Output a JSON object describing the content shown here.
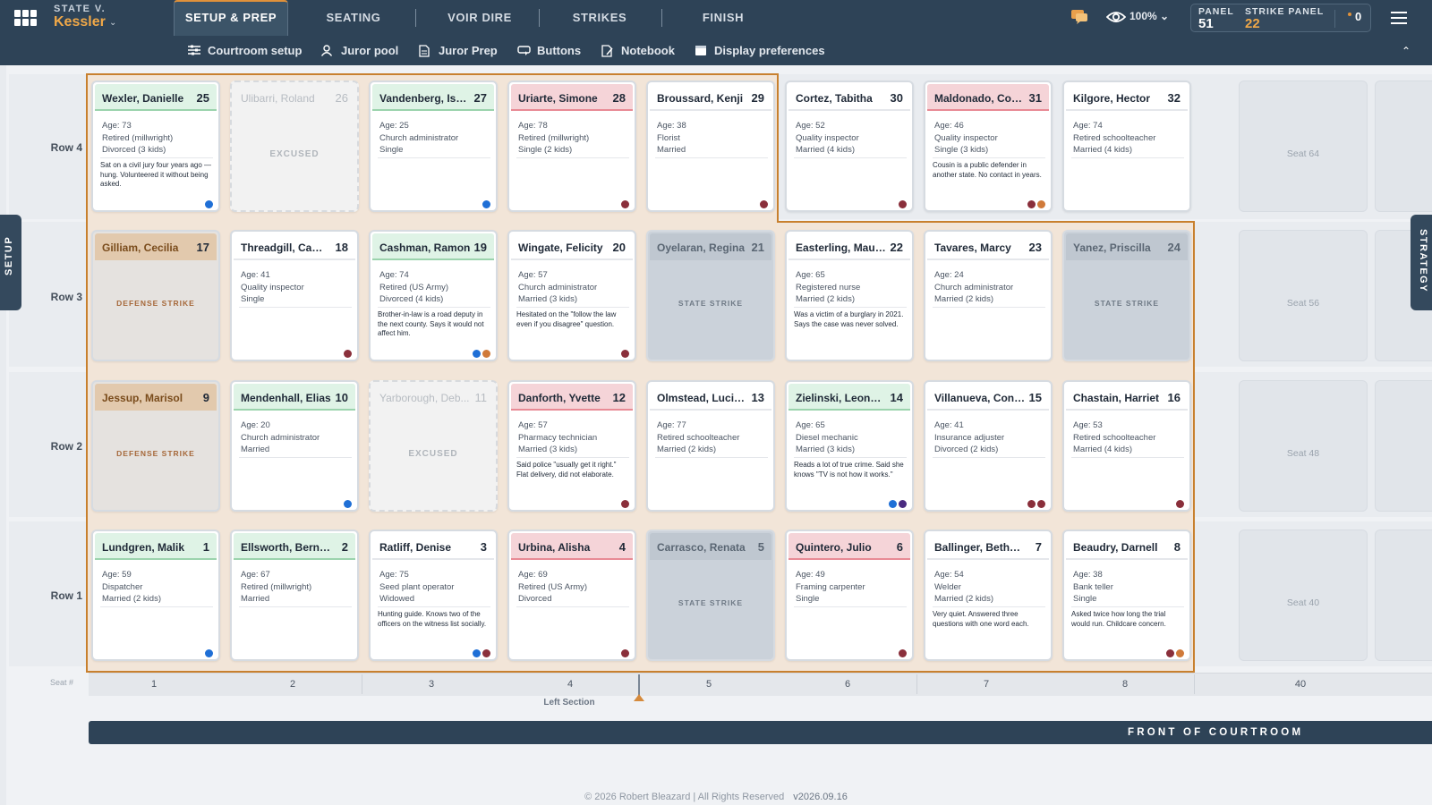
{
  "header": {
    "case_prefix": "STATE V.",
    "case_name": "Kessler",
    "tabs": [
      "SETUP & PREP",
      "SEATING",
      "VOIR DIRE",
      "STRIKES",
      "FINISH"
    ],
    "active_tab": "SETUP & PREP",
    "zoom": "100%",
    "panel_label": "PANEL",
    "panel_value": "51",
    "strike_label": "STRIKE PANEL",
    "strike_value": "22",
    "counter": "0"
  },
  "subnav": [
    "Courtroom setup",
    "Juror pool",
    "Juror Prep",
    "Buttons",
    "Notebook",
    "Display preferences"
  ],
  "side_tabs": {
    "left": "SETUP",
    "right": "STRATEGY"
  },
  "rows": [
    {
      "label": "Row 4",
      "seats": [
        {
          "name": "Wexler, Danielle",
          "seat": "25",
          "style": "green",
          "age": "Age: 73",
          "job": "Retired (millwright)",
          "family": "Divorced (3 kids)",
          "note": "Sat on a civil jury four years ago — hung. Volunteered it without being asked.",
          "dots": [
            "#1f6fd6"
          ]
        },
        {
          "name": "Ulibarri, Roland",
          "seat": "26",
          "style": "excused",
          "status": "EXCUSED"
        },
        {
          "name": "Vandenberg, Isai...",
          "seat": "27",
          "style": "green",
          "age": "Age: 25",
          "job": "Church administrator",
          "family": "Single",
          "note": "",
          "dots": [
            "#1f6fd6"
          ]
        },
        {
          "name": "Uriarte, Simone",
          "seat": "28",
          "style": "red",
          "age": "Age: 78",
          "job": "Retired (millwright)",
          "family": "Single (2 kids)",
          "note": "",
          "dots": [
            "#8a2f3b"
          ]
        },
        {
          "name": "Broussard, Kenji",
          "seat": "29",
          "style": "white",
          "age": "Age: 38",
          "job": "Florist",
          "family": "Married",
          "note": "",
          "dots": [
            "#8a2f3b"
          ]
        },
        {
          "name": "Cortez, Tabitha",
          "seat": "30",
          "style": "white",
          "age": "Age: 52",
          "job": "Quality inspector",
          "family": "Married (4 kids)",
          "note": "",
          "dots": [
            "#8a2f3b"
          ]
        },
        {
          "name": "Maldonado, Cori...",
          "seat": "31",
          "style": "red",
          "age": "Age: 46",
          "job": "Quality inspector",
          "family": "Single (3 kids)",
          "note": "Cousin is a public defender in another state. No contact in years.",
          "dots": [
            "#8a2f3b",
            "#d07a3a"
          ]
        },
        {
          "name": "Kilgore, Hector",
          "seat": "32",
          "style": "white",
          "age": "Age: 74",
          "job": "Retired schoolteacher",
          "family": "Married (4 kids)",
          "note": "",
          "dots": []
        }
      ],
      "extra": "Seat 64"
    },
    {
      "label": "Row 3",
      "seats": [
        {
          "name": "Gilliam, Cecilia",
          "seat": "17",
          "style": "defense",
          "status": "DEFENSE STRIKE"
        },
        {
          "name": "Threadgill, Camille",
          "seat": "18",
          "style": "white",
          "age": "Age: 41",
          "job": "Quality inspector",
          "family": "Single",
          "note": "",
          "dots": [
            "#8a2f3b"
          ]
        },
        {
          "name": "Cashman, Ramon",
          "seat": "19",
          "style": "green",
          "age": "Age: 74",
          "job": "Retired (US Army)",
          "family": "Divorced (4 kids)",
          "note": "Brother-in-law is a road deputy in the next county. Says it would not affect him.",
          "dots": [
            "#1f6fd6",
            "#d07a3a"
          ]
        },
        {
          "name": "Wingate, Felicity",
          "seat": "20",
          "style": "white",
          "age": "Age: 57",
          "job": "Church administrator",
          "family": "Married (3 kids)",
          "note": "Hesitated on the \"follow the law even if you disagree\" question.",
          "dots": [
            "#8a2f3b"
          ]
        },
        {
          "name": "Oyelaran, Regina",
          "seat": "21",
          "style": "state",
          "status": "STATE STRIKE"
        },
        {
          "name": "Easterling, Maur...",
          "seat": "22",
          "style": "white",
          "age": "Age: 65",
          "job": "Registered nurse",
          "family": "Married (2 kids)",
          "note": "Was a victim of a burglary in 2021. Says the case was never solved.",
          "dots": []
        },
        {
          "name": "Tavares, Marcy",
          "seat": "23",
          "style": "white",
          "age": "Age: 24",
          "job": "Church administrator",
          "family": "Married (2 kids)",
          "note": "",
          "dots": []
        },
        {
          "name": "Yanez, Priscilla",
          "seat": "24",
          "style": "state",
          "status": "STATE STRIKE"
        }
      ],
      "extra": "Seat 56"
    },
    {
      "label": "Row 2",
      "seats": [
        {
          "name": "Jessup, Marisol",
          "seat": "9",
          "style": "defense",
          "status": "DEFENSE STRIKE"
        },
        {
          "name": "Mendenhall, Elias",
          "seat": "10",
          "style": "green",
          "age": "Age: 20",
          "job": "Church administrator",
          "family": "Married",
          "note": "",
          "dots": [
            "#1f6fd6"
          ]
        },
        {
          "name": "Yarborough, Deb...",
          "seat": "11",
          "style": "excused",
          "status": "EXCUSED"
        },
        {
          "name": "Danforth, Yvette",
          "seat": "12",
          "style": "red",
          "age": "Age: 57",
          "job": "Pharmacy technician",
          "family": "Married (3 kids)",
          "note": "Said police \"usually get it right.\" Flat delivery, did not elaborate.",
          "dots": [
            "#8a2f3b"
          ]
        },
        {
          "name": "Olmstead, Lucinda",
          "seat": "13",
          "style": "white",
          "age": "Age: 77",
          "job": "Retired schoolteacher",
          "family": "Married (2 kids)",
          "note": "",
          "dots": []
        },
        {
          "name": "Zielinski, Leonard",
          "seat": "14",
          "style": "green",
          "age": "Age: 65",
          "job": "Diesel mechanic",
          "family": "Married (3 kids)",
          "note": "Reads a lot of true crime. Said she knows \"TV is not how it works.\"",
          "dots": [
            "#1f6fd6",
            "#4a2a80"
          ]
        },
        {
          "name": "Villanueva, Cons...",
          "seat": "15",
          "style": "white",
          "age": "Age: 41",
          "job": "Insurance adjuster",
          "family": "Divorced (2 kids)",
          "note": "",
          "dots": [
            "#8a2f3b",
            "#8a2f3b"
          ]
        },
        {
          "name": "Chastain, Harriet",
          "seat": "16",
          "style": "white",
          "age": "Age: 53",
          "job": "Retired schoolteacher",
          "family": "Married (4 kids)",
          "note": "",
          "dots": [
            "#8a2f3b"
          ]
        }
      ],
      "extra": "Seat 48"
    },
    {
      "label": "Row 1",
      "seats": [
        {
          "name": "Lundgren, Malik",
          "seat": "1",
          "style": "green",
          "age": "Age: 59",
          "job": "Dispatcher",
          "family": "Married (2 kids)",
          "note": "",
          "dots": [
            "#1f6fd6"
          ]
        },
        {
          "name": "Ellsworth, Bernard",
          "seat": "2",
          "style": "green",
          "age": "Age: 67",
          "job": "Retired (millwright)",
          "family": "Married",
          "note": "",
          "dots": []
        },
        {
          "name": "Ratliff, Denise",
          "seat": "3",
          "style": "white",
          "age": "Age: 75",
          "job": "Seed plant operator",
          "family": "Widowed",
          "note": "Hunting guide. Knows two of the officers on the witness list socially.",
          "dots": [
            "#1f6fd6",
            "#8a2f3b"
          ]
        },
        {
          "name": "Urbina, Alisha",
          "seat": "4",
          "style": "red",
          "age": "Age: 69",
          "job": "Retired (US Army)",
          "family": "Divorced",
          "note": "",
          "dots": [
            "#8a2f3b"
          ]
        },
        {
          "name": "Carrasco, Renata",
          "seat": "5",
          "style": "state",
          "status": "STATE STRIKE"
        },
        {
          "name": "Quintero, Julio",
          "seat": "6",
          "style": "red",
          "age": "Age: 49",
          "job": "Framing carpenter",
          "family": "Single",
          "note": "",
          "dots": [
            "#8a2f3b"
          ]
        },
        {
          "name": "Ballinger, Bethany",
          "seat": "7",
          "style": "white",
          "age": "Age: 54",
          "job": "Welder",
          "family": "Married (2 kids)",
          "note": "Very quiet. Answered three questions with one word each.",
          "dots": []
        },
        {
          "name": "Beaudry, Darnell",
          "seat": "8",
          "style": "white",
          "age": "Age: 38",
          "job": "Bank teller",
          "family": "Single",
          "note": "Asked twice how long the trial would run. Childcare concern.",
          "dots": [
            "#8a2f3b",
            "#d07a3a"
          ]
        }
      ],
      "extra": "Seat 40"
    }
  ],
  "seat_axis": {
    "label": "Seat #",
    "numbers": [
      "1",
      "2",
      "3",
      "4",
      "5",
      "6",
      "7",
      "8",
      "40"
    ],
    "section_label": "Left Section"
  },
  "front_label": "FRONT OF COURTROOM",
  "footer": {
    "copyright": "© 2026 Robert Bleazard | All Rights Reserved",
    "version": "v2026.09.16"
  }
}
